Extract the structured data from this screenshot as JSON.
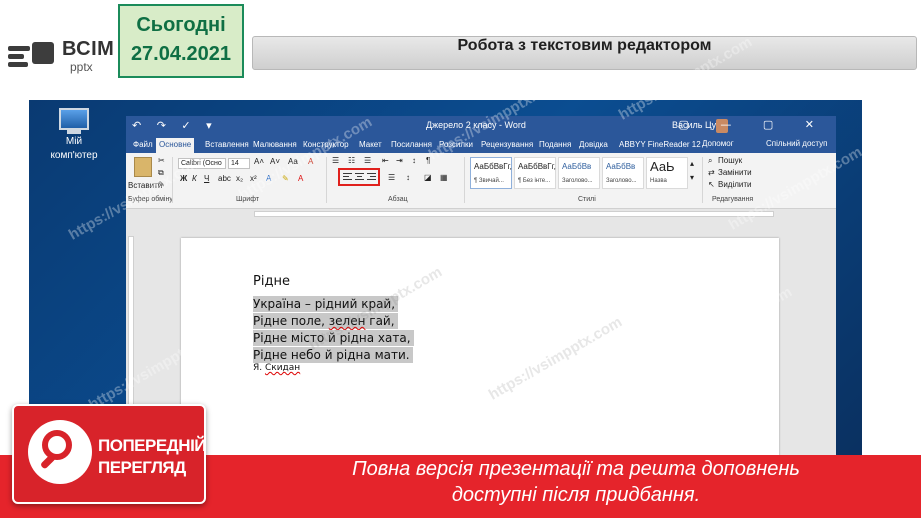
{
  "slide": {
    "logo_text": "ВСІМ",
    "logo_sub": "pptx",
    "date_label": "Сьогодні",
    "date_value": "27.04.2021",
    "title": "Робота з текстовим редактором"
  },
  "desktop": {
    "icon_label_1": "Мій",
    "icon_label_2": "комп'ютер"
  },
  "word": {
    "qat": "↶ ↷ ✓ ▾",
    "doc_title": "Джерело 2 класу - Word",
    "user": "Василь Цугі",
    "window_controls": "▢ — ▢ ✕",
    "tabs": [
      "Файл",
      "Основне",
      "Вставлення",
      "Малювання",
      "Конструктор",
      "Макет",
      "Посилання",
      "Розсилки",
      "Рецензування",
      "Подання",
      "Довідка",
      "ABBYY FineReader 12"
    ],
    "tell_me": "Допомог",
    "share": "Спільний доступ",
    "ribbon": {
      "paste_label": "Вставити",
      "font_name": "Calibri (Осно",
      "font_size": "14",
      "group_clipboard": "Буфер обміну",
      "group_font": "Шрифт",
      "group_paragraph": "Абзац",
      "group_styles": "Стилі",
      "group_editing": "Редагування",
      "styles": [
        {
          "sample": "АаБбВвГг,",
          "name": "¶ Звичай..."
        },
        {
          "sample": "АаБбВвГг,",
          "name": "¶ Без інте..."
        },
        {
          "sample": "АаБбВв",
          "name": "Заголово..."
        },
        {
          "sample": "АаБбВв",
          "name": "Заголово..."
        },
        {
          "sample": "АаЬ",
          "name": "Назва"
        }
      ],
      "find": "Пошук",
      "replace": "Замінити",
      "select": "Виділити"
    },
    "document": {
      "title": "Рідне",
      "lines": [
        "Україна – рідний край,",
        "Рідне поле, зелен гай,",
        "Рідне місто й рідна хата,",
        "Рідне небо й рідна мати."
      ],
      "author": "Я. Скидан"
    }
  },
  "watermark": "https://vsimpptx.com",
  "promo": {
    "badge_line1": "ПОПЕРЕДНІЙ",
    "badge_line2": "ПЕРЕГЛЯД",
    "line1": "Повна версія презентації та решта доповнень",
    "line2": "доступні після придбання."
  },
  "colors": {
    "word_blue": "#2b579a",
    "promo_red": "#e5242b",
    "date_green": "#0f6f44"
  }
}
